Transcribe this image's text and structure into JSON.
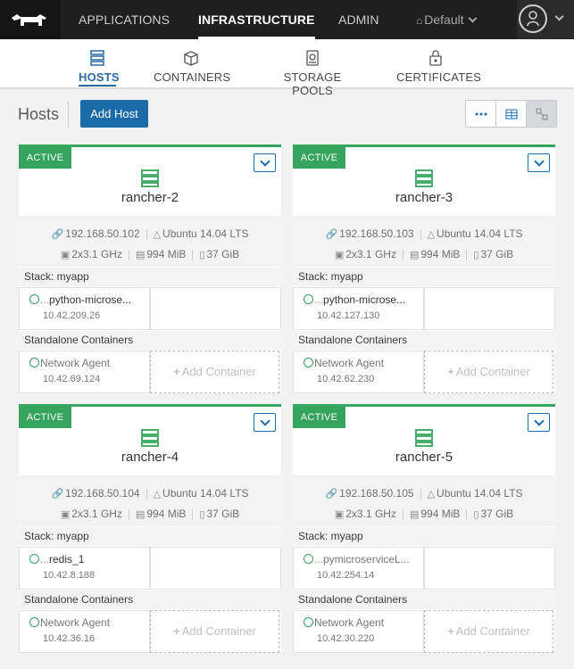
{
  "nav": {
    "items": [
      "APPLICATIONS",
      "INFRASTRUCTURE",
      "ADMIN"
    ],
    "active": "INFRASTRUCTURE",
    "environment": "Default"
  },
  "subnav": {
    "items": [
      {
        "label": "HOSTS",
        "icon": "hosts-icon"
      },
      {
        "label": "CONTAINERS",
        "icon": "container-icon"
      },
      {
        "label": "STORAGE POOLS",
        "icon": "storage-icon"
      },
      {
        "label": "CERTIFICATES",
        "icon": "certificate-icon"
      }
    ],
    "active": "HOSTS"
  },
  "page": {
    "title": "Hosts",
    "add_button": "Add Host"
  },
  "labels": {
    "active": "ACTIVE",
    "standalone": "Standalone Containers",
    "add_container": "Add Container",
    "ellipsis": "..."
  },
  "hosts": [
    {
      "name": "rancher-2",
      "state": "ACTIVE",
      "ip": "192.168.50.102",
      "os": "Ubuntu 14.04 LTS",
      "cpu": "2x3.1 GHz",
      "mem": "994 MiB",
      "disk": "37 GiB",
      "stack": "Stack: myapp",
      "stack_container": {
        "name": "python-microse...",
        "ip": "10.42.209.26"
      },
      "standalone": {
        "name": "Network Agent",
        "ip": "10.42.69.124"
      }
    },
    {
      "name": "rancher-3",
      "state": "ACTIVE",
      "ip": "192.168.50.103",
      "os": "Ubuntu 14.04 LTS",
      "cpu": "2x3.1 GHz",
      "mem": "994 MiB",
      "disk": "37 GiB",
      "stack": "Stack: myapp",
      "stack_container": {
        "name": "python-microse...",
        "ip": "10.42.127.130"
      },
      "standalone": {
        "name": "Network Agent",
        "ip": "10.42.62.230"
      }
    },
    {
      "name": "rancher-4",
      "state": "ACTIVE",
      "ip": "192.168.50.104",
      "os": "Ubuntu 14.04 LTS",
      "cpu": "2x3.1 GHz",
      "mem": "994 MiB",
      "disk": "37 GiB",
      "stack": "Stack: myapp",
      "stack_container": {
        "name": "redis_1",
        "ip": "10.42.8.188"
      },
      "standalone": {
        "name": "Network Agent",
        "ip": "10.42.36.16"
      }
    },
    {
      "name": "rancher-5",
      "state": "ACTIVE",
      "ip": "192.168.50.105",
      "os": "Ubuntu 14.04 LTS",
      "cpu": "2x3.1 GHz",
      "mem": "994 MiB",
      "disk": "37 GiB",
      "stack": "Stack: myapp",
      "stack_container": {
        "name": "pymicroserviceL...",
        "ip": "10.42.254.14"
      },
      "standalone": {
        "name": "Network Agent",
        "ip": "10.42.30.220"
      }
    }
  ],
  "colors": {
    "active_green": "#35a45d",
    "primary_blue": "#1b6ba8",
    "nav_dark": "#1f1f1f"
  }
}
